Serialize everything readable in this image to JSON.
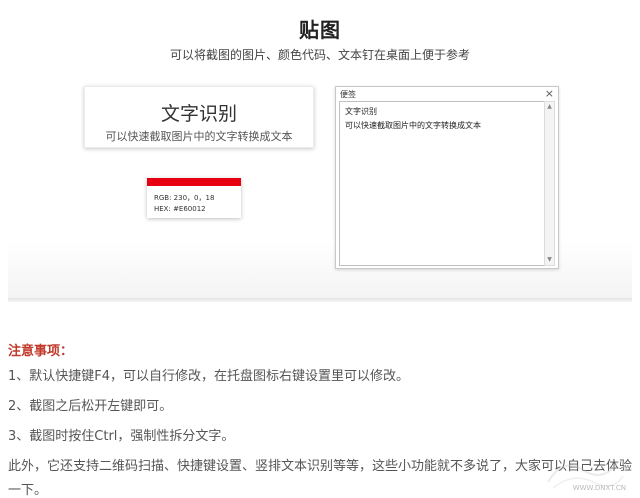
{
  "hero": {
    "title": "贴图",
    "subtitle": "可以将截图的图片、颜色代码、文本钉在桌面上便于参考"
  },
  "ocr_card": {
    "title": "文字识别",
    "subtitle": "可以快速截取图片中的文字转换成文本"
  },
  "color_card": {
    "accent_color": "#E60012",
    "rgb_line": "RGB:   230，0，18",
    "hex_line": "HEX:   #E60012"
  },
  "note_window": {
    "title": "便签",
    "close_icon": "close-icon",
    "lines": [
      "文字识别",
      "可以快速截取图片中的文字转换成文本"
    ]
  },
  "notes": {
    "heading": "注意事项：",
    "items": [
      "1、默认快捷键F4，可以自行修改，在托盘图标右键设置里可以修改。",
      "2、截图之后松开左键即可。",
      "3、截图时按住Ctrl，强制性拆分文字。"
    ],
    "extra": "此外，它还支持二维码扫描、快捷键设置、竖排文本识别等等，这些小功能就不多说了，大家可以自己去体验一下。"
  },
  "watermark": {
    "text": "WWW.DNXT.CN"
  }
}
